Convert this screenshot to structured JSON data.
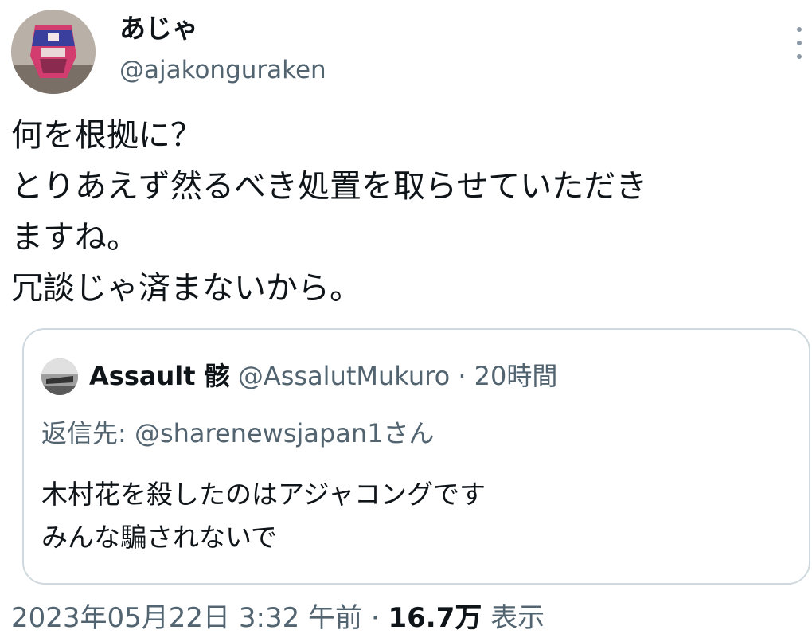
{
  "author": {
    "display_name": "あじゃ",
    "handle": "@ajakonguraken",
    "avatar_icon": "masked-wrestler-avatar"
  },
  "more_icon": "more-vertical-icon",
  "tweet_text": [
    "何を根拠に？",
    "とりあえず然るべき処置を取らせていただき",
    "ますね。",
    "冗談じゃ済まないから。"
  ],
  "quote": {
    "display_name": "Assault 骸",
    "handle": "@AssalutMukuro",
    "separator": "·",
    "time": "20時間",
    "reply_label": "返信先:",
    "reply_to": "@sharenewsjapan1さん",
    "text": [
      "木村花を殺したのはアジャコングです",
      "みんな騙されないで"
    ]
  },
  "meta": {
    "date": "2023年05月22日",
    "time": "3:32 午前",
    "separator": "·",
    "views_count": "16.7万",
    "views_label": "表示"
  },
  "colors": {
    "text_primary": "#0f1419",
    "text_secondary": "#536471",
    "border": "#cfd9de"
  }
}
